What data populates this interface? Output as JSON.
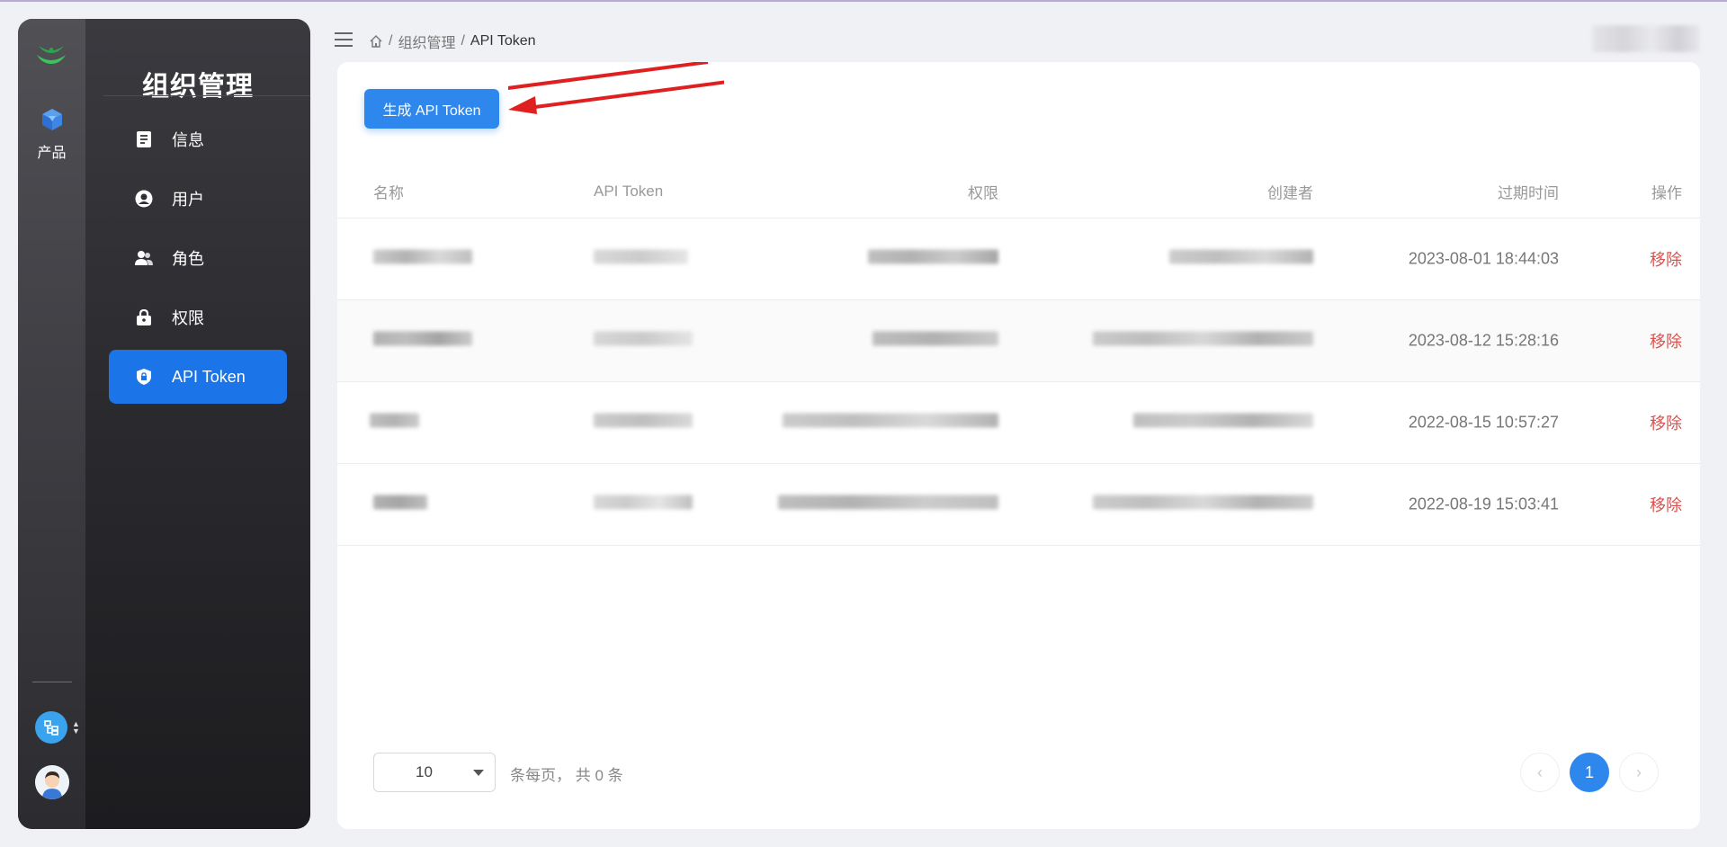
{
  "sidebar": {
    "rail": {
      "product_label": "产品",
      "icons": [
        "logo-icon",
        "product-cube-icon",
        "org-switch-icon",
        "avatar"
      ]
    },
    "title": "组织管理",
    "items": [
      {
        "label": "信息",
        "icon": "document-icon"
      },
      {
        "label": "用户",
        "icon": "user-circle-icon"
      },
      {
        "label": "角色",
        "icon": "people-icon"
      },
      {
        "label": "权限",
        "icon": "lock-icon"
      },
      {
        "label": "API Token",
        "icon": "shield-icon",
        "active": true
      }
    ]
  },
  "header": {
    "breadcrumb": {
      "home_icon": "home-icon",
      "sep": "/",
      "parent": "组织管理",
      "current": "API Token"
    }
  },
  "main": {
    "generate_button": "生成 API Token",
    "table": {
      "columns": [
        "名称",
        "API Token",
        "权限",
        "创建者",
        "过期时间",
        "操作"
      ],
      "rows": [
        {
          "expires": "2023-08-01 18:44:03",
          "action": "移除"
        },
        {
          "expires": "2023-08-12 15:28:16",
          "action": "移除"
        },
        {
          "expires": "2022-08-15 10:57:27",
          "action": "移除"
        },
        {
          "expires": "2022-08-19 15:03:41",
          "action": "移除"
        }
      ]
    },
    "pagination": {
      "page_size": "10",
      "info": "条每页，  共 0 条",
      "prev": "‹",
      "current_page": "1",
      "next": "›"
    }
  },
  "colors": {
    "accent": "#1b74e8",
    "button": "#2d87ed",
    "danger": "#d9534f",
    "annotation_arrow": "#e02020"
  }
}
